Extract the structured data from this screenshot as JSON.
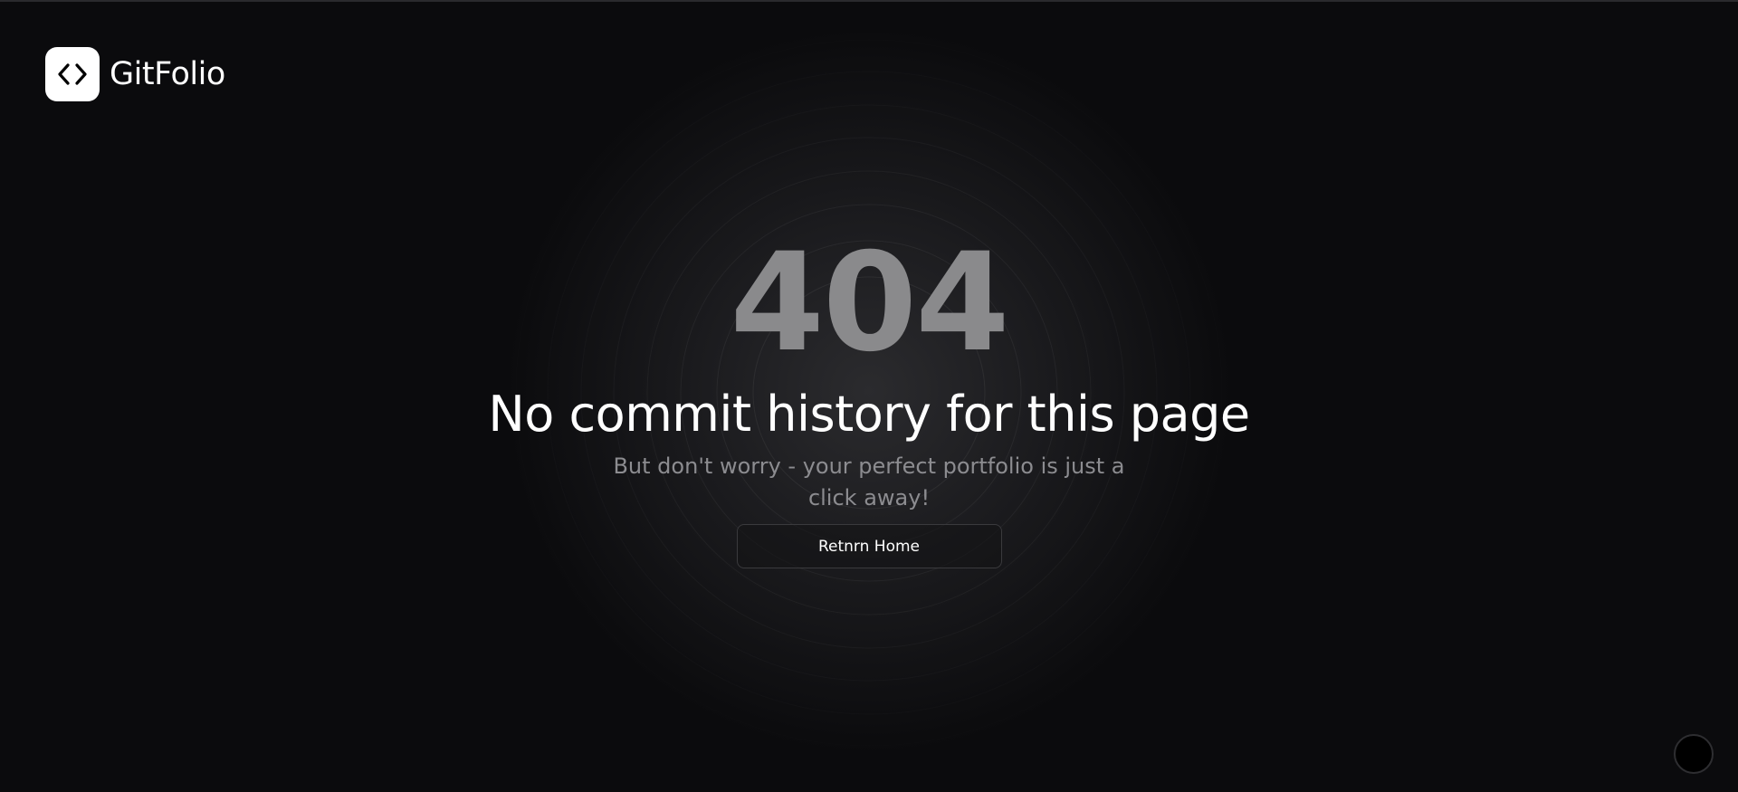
{
  "brand": {
    "name": "GitFolio",
    "icon": "code-brackets-icon"
  },
  "error": {
    "code": "404",
    "title": "No commit history for this page",
    "message": "But don't worry - your perfect portfolio is just a click away!"
  },
  "actions": {
    "home_label": "Retnrn Home"
  },
  "colors": {
    "background": "#0b0b0d",
    "code_text": "#8a8a8c",
    "title_text": "#ffffff",
    "message_text": "#8c8c90",
    "logo_bg": "#ffffff"
  }
}
